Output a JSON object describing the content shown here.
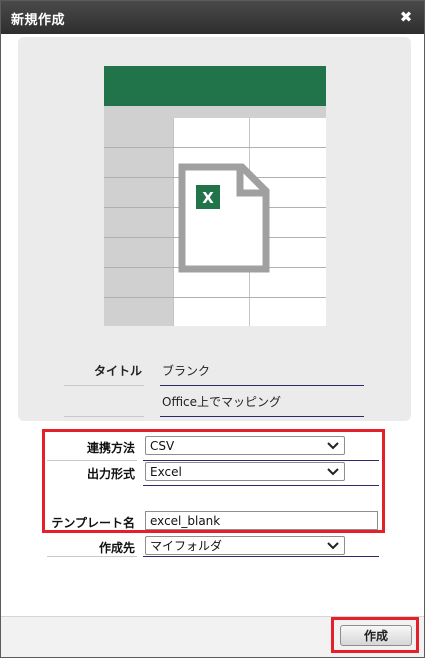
{
  "dialog": {
    "title": "新規作成",
    "close_icon": "close-icon",
    "close_glyph": "✖"
  },
  "preview": {
    "icon": "excel-spreadsheet-icon",
    "badge_letter": "X",
    "colors": {
      "header": "#21734a",
      "panel": "#ebebeb",
      "doc_stroke": "#a0a0a0"
    }
  },
  "info": {
    "title_label": "タイトル",
    "title_value": "ブランク",
    "description_value": "Office上でマッピング"
  },
  "form": {
    "link_method": {
      "label": "連携方法",
      "value": "CSV"
    },
    "output_format": {
      "label": "出力形式",
      "value": "Excel"
    },
    "template_name": {
      "label": "テンプレート名",
      "value": "excel_blank"
    },
    "destination": {
      "label": "作成先",
      "value": "マイフォルダ"
    }
  },
  "footer": {
    "create_label": "作成"
  },
  "accent": {
    "highlight": "#e4202b"
  }
}
